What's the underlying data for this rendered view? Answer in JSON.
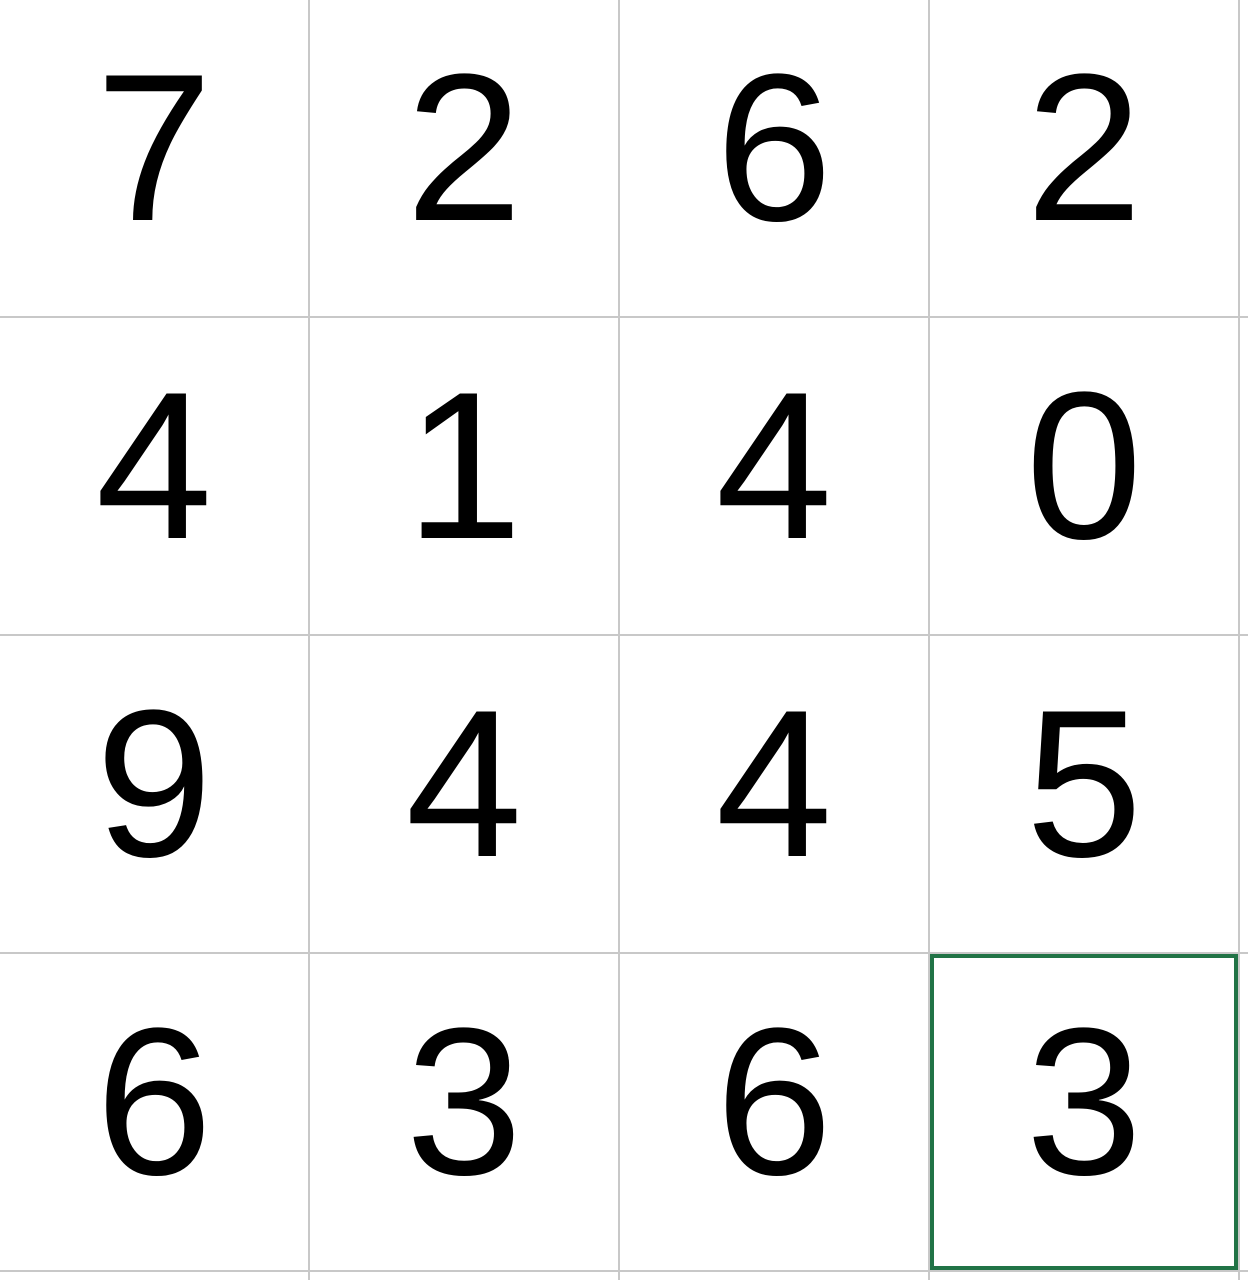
{
  "spreadsheet": {
    "rows": [
      {
        "cells": [
          "7",
          "2",
          "6",
          "2"
        ]
      },
      {
        "cells": [
          "4",
          "1",
          "4",
          "0"
        ]
      },
      {
        "cells": [
          "9",
          "4",
          "4",
          "5"
        ]
      },
      {
        "cells": [
          "6",
          "3",
          "6",
          "3"
        ]
      }
    ],
    "selected": {
      "row": 3,
      "col": 3
    },
    "colors": {
      "grid_line": "#c8c8c8",
      "selection": "#217346",
      "text": "#000000",
      "background": "#ffffff"
    }
  }
}
